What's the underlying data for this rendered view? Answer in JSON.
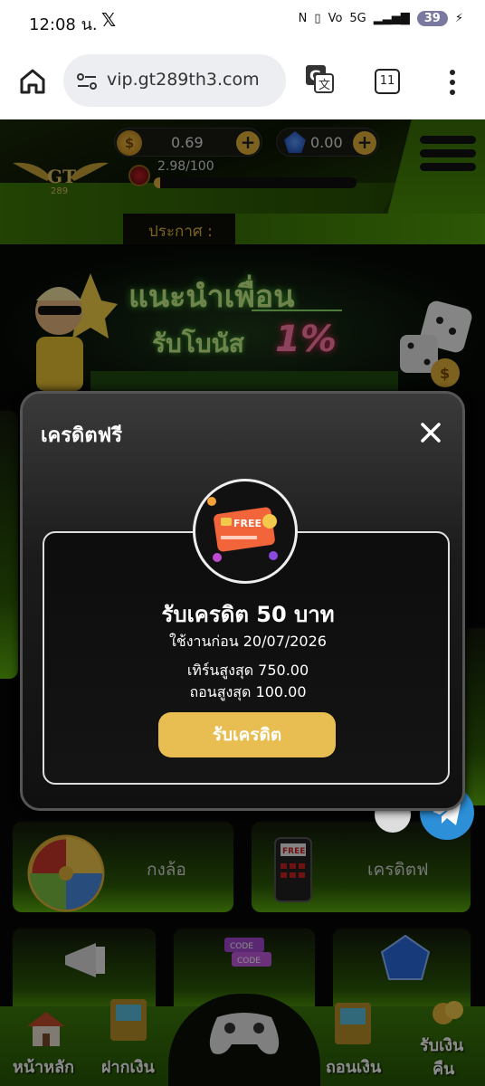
{
  "status_bar": {
    "time": "12:08 น.",
    "x_icon": "x-logo-icon",
    "network": "5G",
    "battery": "39"
  },
  "browser": {
    "url": "vip.gt289th3.com",
    "tab_count": "11"
  },
  "header": {
    "coin_balance": "0.69",
    "gem_balance": "0.00",
    "level_progress_text": "2.98/100",
    "level_progress_fraction": 0.0298,
    "announcement_label": "ประกาศ :",
    "accent_color": "#4f9a0a",
    "gold_color": "#e3b23a"
  },
  "banner": {
    "title": "แนะนำเพื่อน",
    "subtitle": "รับโบนัส",
    "percent": "1%",
    "logo_text": "GT 289"
  },
  "tiles": {
    "wheel_label": "กงล้อ",
    "free_credit_label": "เครดิตฟ"
  },
  "bottom_nav": {
    "home": "หน้าหลัก",
    "deposit": "ฝากเงิน",
    "withdraw": "ถอนเงิน",
    "cashback_line1": "รับเงิน",
    "cashback_line2": "คืน"
  },
  "modal": {
    "title": "เครดิตฟรี",
    "icon_badge": "FREE",
    "heading": "รับเครดิต 50 บาท",
    "expire_text": "ใช้งานก่อน 20/07/2026",
    "max_turnover": "เทิร์นสูงสุด 750.00",
    "max_withdraw": "ถอนสูงสุด 100.00",
    "claim_button": "รับเครดิต"
  }
}
